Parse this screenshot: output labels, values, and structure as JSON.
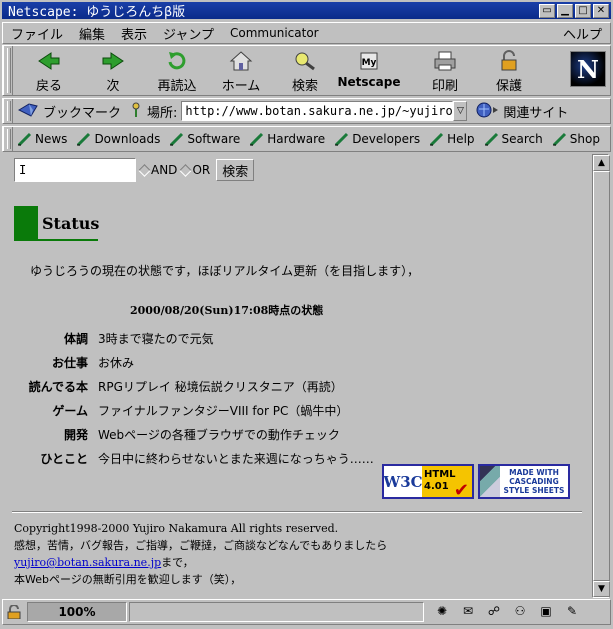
{
  "window": {
    "title": "Netscape: ゆうじろんちβ版"
  },
  "menu": [
    "ファイル",
    "編集",
    "表示",
    "ジャンプ",
    "Communicator"
  ],
  "menu_help": "ヘルプ",
  "toolbar": [
    {
      "label": "戻る",
      "icon": "back-arrow-icon"
    },
    {
      "label": "次",
      "icon": "forward-arrow-icon"
    },
    {
      "label": "再読込",
      "icon": "reload-icon"
    },
    {
      "label": "ホーム",
      "icon": "home-icon"
    },
    {
      "label": "検索",
      "icon": "search-icon"
    },
    {
      "label": "Netscape",
      "icon": "netscape-icon"
    },
    {
      "label": "印刷",
      "icon": "print-icon"
    },
    {
      "label": "保護",
      "icon": "lock-icon"
    }
  ],
  "location": {
    "bookmark_label": "ブックマーク",
    "place_label": "場所:",
    "url": "http://www.botan.sakura.ne.jp/~yujiro/",
    "related_label": "関連サイト"
  },
  "personal": [
    "News",
    "Downloads",
    "Software",
    "Hardware",
    "Developers",
    "Help",
    "Search",
    "Shop"
  ],
  "page": {
    "search_value": "I",
    "radio_and": "AND",
    "radio_or": "OR",
    "search_button": "検索",
    "heading": "Status",
    "intro": "ゆうじろうの現在の状態です，ほぼリアルタイム更新（を目指します），",
    "timestamp": "2000/08/20(Sun)17:08時点の状態",
    "rows": [
      {
        "key": "体調",
        "value": "3時まで寝たので元気"
      },
      {
        "key": "お仕事",
        "value": "お休み"
      },
      {
        "key": "読んでる本",
        "value": "RPGリプレイ 秘境伝説クリスタニア（再読）"
      },
      {
        "key": "ゲーム",
        "value": "ファイナルファンタジーVIII for PC（蝸牛中）"
      },
      {
        "key": "開発",
        "value": "Webページの各種ブラウザでの動作チェック"
      },
      {
        "key": "ひとこと",
        "value": "今日中に終わらせないとまた来週になっちゃう……"
      }
    ],
    "badge_w3c_left": "W3C",
    "badge_w3c_text": "HTML 4.01",
    "badge_css_text": "MADE WITH CASCADING STYLE SHEETS",
    "copyright": "Copyright1998-2000 Yujiro Nakamura All rights reserved.",
    "contact_line": "感想，苦情，バグ報告，ご指導，ご鞭撻，ご商談などなんでもありましたら",
    "email": "yujiro@botan.sakura.ne.jp",
    "email_suffix": "まで，",
    "quote_line": "本Webページの無断引用を歓迎します（笑），"
  },
  "status": {
    "zoom": "100%"
  }
}
